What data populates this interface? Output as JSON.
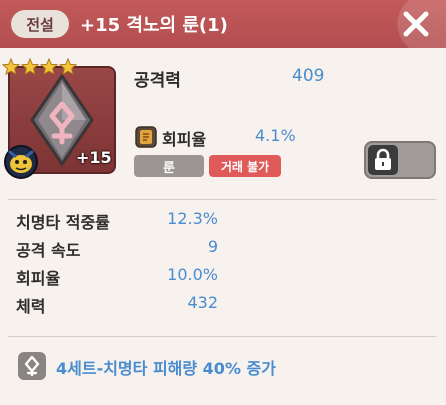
{
  "header": {
    "grade": "전설",
    "title": "+15 격노의 룬(1)"
  },
  "item": {
    "stars": 4,
    "level": "+15",
    "main_stat": {
      "label": "공격력",
      "value": "409"
    },
    "sub_stat": {
      "label": "회피율",
      "value": "4.1%"
    },
    "tags": {
      "type": "룬",
      "trade": "거래 불가"
    },
    "locked": true
  },
  "stats": [
    {
      "label": "치명타 적중률",
      "value": "12.3%"
    },
    {
      "label": "공격 속도",
      "value": "9"
    },
    {
      "label": "회피율",
      "value": "10.0%"
    },
    {
      "label": "체력",
      "value": "432"
    }
  ],
  "set_effect": "4세트-치명타 피해량 40% 증가",
  "colors": {
    "header": "#b24d4f",
    "value_blue": "#4a8cd0",
    "trade_red": "#e05a5a",
    "star_gold": "#f3c43a"
  },
  "icons": {
    "close": "close-icon",
    "rune": "rune-crystal-icon",
    "star": "star-icon",
    "pet": "pet-avatar-icon",
    "sub_stat": "evasion-stat-icon",
    "lock": "lock-icon",
    "set": "rune-set-icon"
  }
}
